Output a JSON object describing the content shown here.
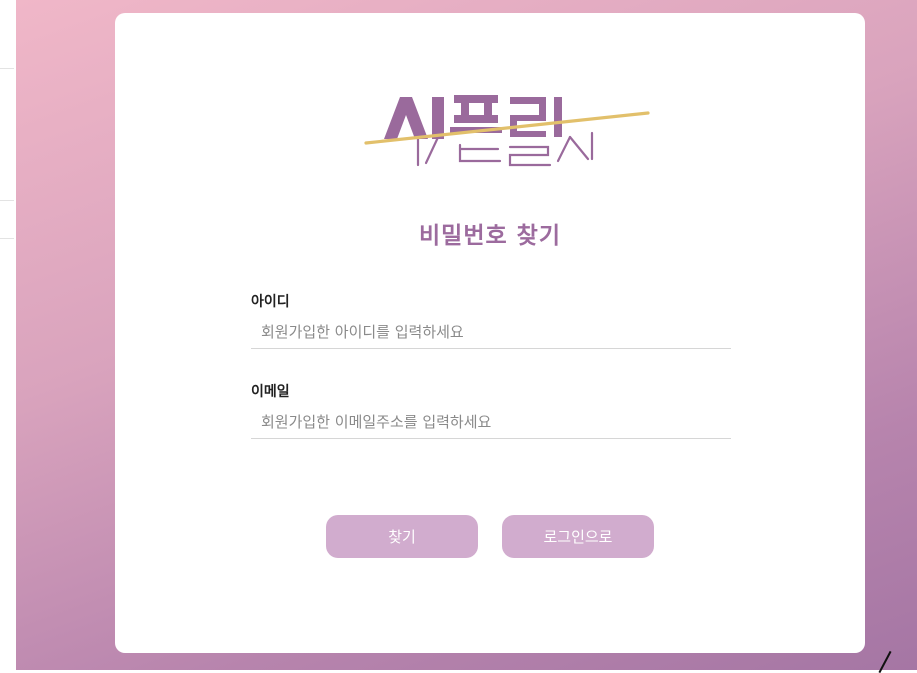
{
  "brand": {
    "logo_text": "씨플릿",
    "colors": {
      "purple": "#9a6a9c",
      "gold": "#e2c06b",
      "title": "#9c6b9e",
      "button": "#d1acce"
    }
  },
  "page": {
    "title": "비밀번호 찾기"
  },
  "form": {
    "id_label": "아이디",
    "id_placeholder": "회원가입한 아이디를 입력하세요",
    "email_label": "이메일",
    "email_placeholder": "회원가입한 이메일주소를 입력하세요"
  },
  "buttons": {
    "find": "찾기",
    "to_login": "로그인으로"
  }
}
